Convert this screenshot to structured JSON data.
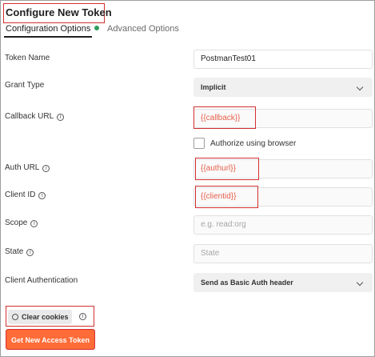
{
  "panel": {
    "title": "Configure New Token",
    "tabs": [
      {
        "label": "Configuration Options",
        "active": true,
        "status_dot_color": "#2e9e5b"
      },
      {
        "label": "Advanced Options",
        "active": false
      }
    ]
  },
  "form": {
    "token_name": {
      "label": "Token Name",
      "value": "PostmanTest01"
    },
    "grant_type": {
      "label": "Grant Type",
      "value": "Implicit"
    },
    "callback_url": {
      "label": "Callback URL",
      "value": "{{callback}}"
    },
    "authorize_browser": {
      "label": "Authorize using browser",
      "checked": false
    },
    "auth_url": {
      "label": "Auth URL",
      "value": "{{authurl}}"
    },
    "client_id": {
      "label": "Client ID",
      "value": "{{clientid}}"
    },
    "scope": {
      "label": "Scope",
      "placeholder": "e.g. read:org"
    },
    "state": {
      "label": "State",
      "placeholder": "State"
    },
    "client_authentication": {
      "label": "Client Authentication",
      "value": "Send as Basic Auth header"
    }
  },
  "actions": {
    "clear_cookies": "Clear cookies",
    "get_token": "Get New Access Token"
  },
  "info_glyph": "i",
  "colors": {
    "accent": "#ff6c37",
    "variable_text": "#e65f4a",
    "highlight_box": "#d32f2f",
    "status_dot": "#2e9e5b"
  }
}
